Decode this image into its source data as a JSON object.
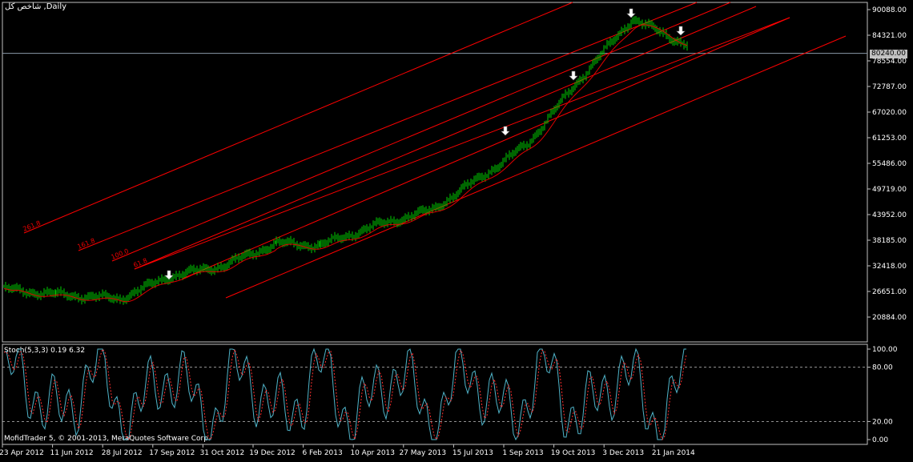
{
  "window": {
    "title": "شاخص کل ,Daily",
    "current_price": "80240.00",
    "copyright": "MofidTrader 5, © 2001-2013, MetaQuotes Software Corp."
  },
  "colors": {
    "background": "#000000",
    "grid": "#c0c0c0",
    "up_bar": "#00cc00",
    "down_bar": "#00cc00",
    "moving_average": "#e00000",
    "fibo_channel": "#ff0000",
    "stoch_main": "#4fb3c8",
    "stoch_signal": "#ff3030"
  },
  "price_axis": {
    "ticks": [
      "90088.00",
      "84321.00",
      "78554.00",
      "72787.00",
      "67020.00",
      "61253.00",
      "55486.00",
      "49719.00",
      "43952.00",
      "38185.00",
      "32418.00",
      "26651.00",
      "20884.00"
    ]
  },
  "stoch_axis": {
    "ticks": [
      "100.00",
      "80.00",
      "20.00",
      "0.00"
    ]
  },
  "stoch": {
    "label": "Stoch(5,3,3) 0.19 6.32"
  },
  "time_axis": {
    "ticks": [
      "23 Apr 2012",
      "11 Jun 2012",
      "28 Jul 2012",
      "17 Sep 2012",
      "31 Oct 2012",
      "19 Dec 2012",
      "6 Feb 2013",
      "10 Apr 2013",
      "27 May 2013",
      "15 Jul 2013",
      "1 Sep 2013",
      "19 Oct 2013",
      "3 Dec 2013",
      "21 Jan 2014"
    ]
  },
  "fibo_levels": [
    "261.8",
    "161.8",
    "100.0",
    "61.8"
  ],
  "markers": [
    "arrow-down-icon",
    "arrow-down-icon",
    "arrow-down-icon",
    "arrow-down-icon",
    "arrow-down-icon"
  ],
  "chart_data": {
    "type": "line",
    "title": "شاخص کل ,Daily",
    "x": [
      "23 Apr 2012",
      "11 Jun 2012",
      "28 Jul 2012",
      "17 Sep 2012",
      "31 Oct 2012",
      "19 Dec 2012",
      "6 Feb 2013",
      "10 Apr 2013",
      "27 May 2013",
      "15 Jul 2013",
      "1 Sep 2013",
      "19 Oct 2013",
      "3 Dec 2013",
      "21 Jan 2014"
    ],
    "series": [
      {
        "values": [
          27200,
          26000,
          25000,
          30000,
          32500,
          37500,
          37000,
          41500,
          45000,
          56000,
          60000,
          73500,
          88000,
          82000
        ]
      }
    ],
    "ylim": [
      20884,
      90088
    ]
  }
}
